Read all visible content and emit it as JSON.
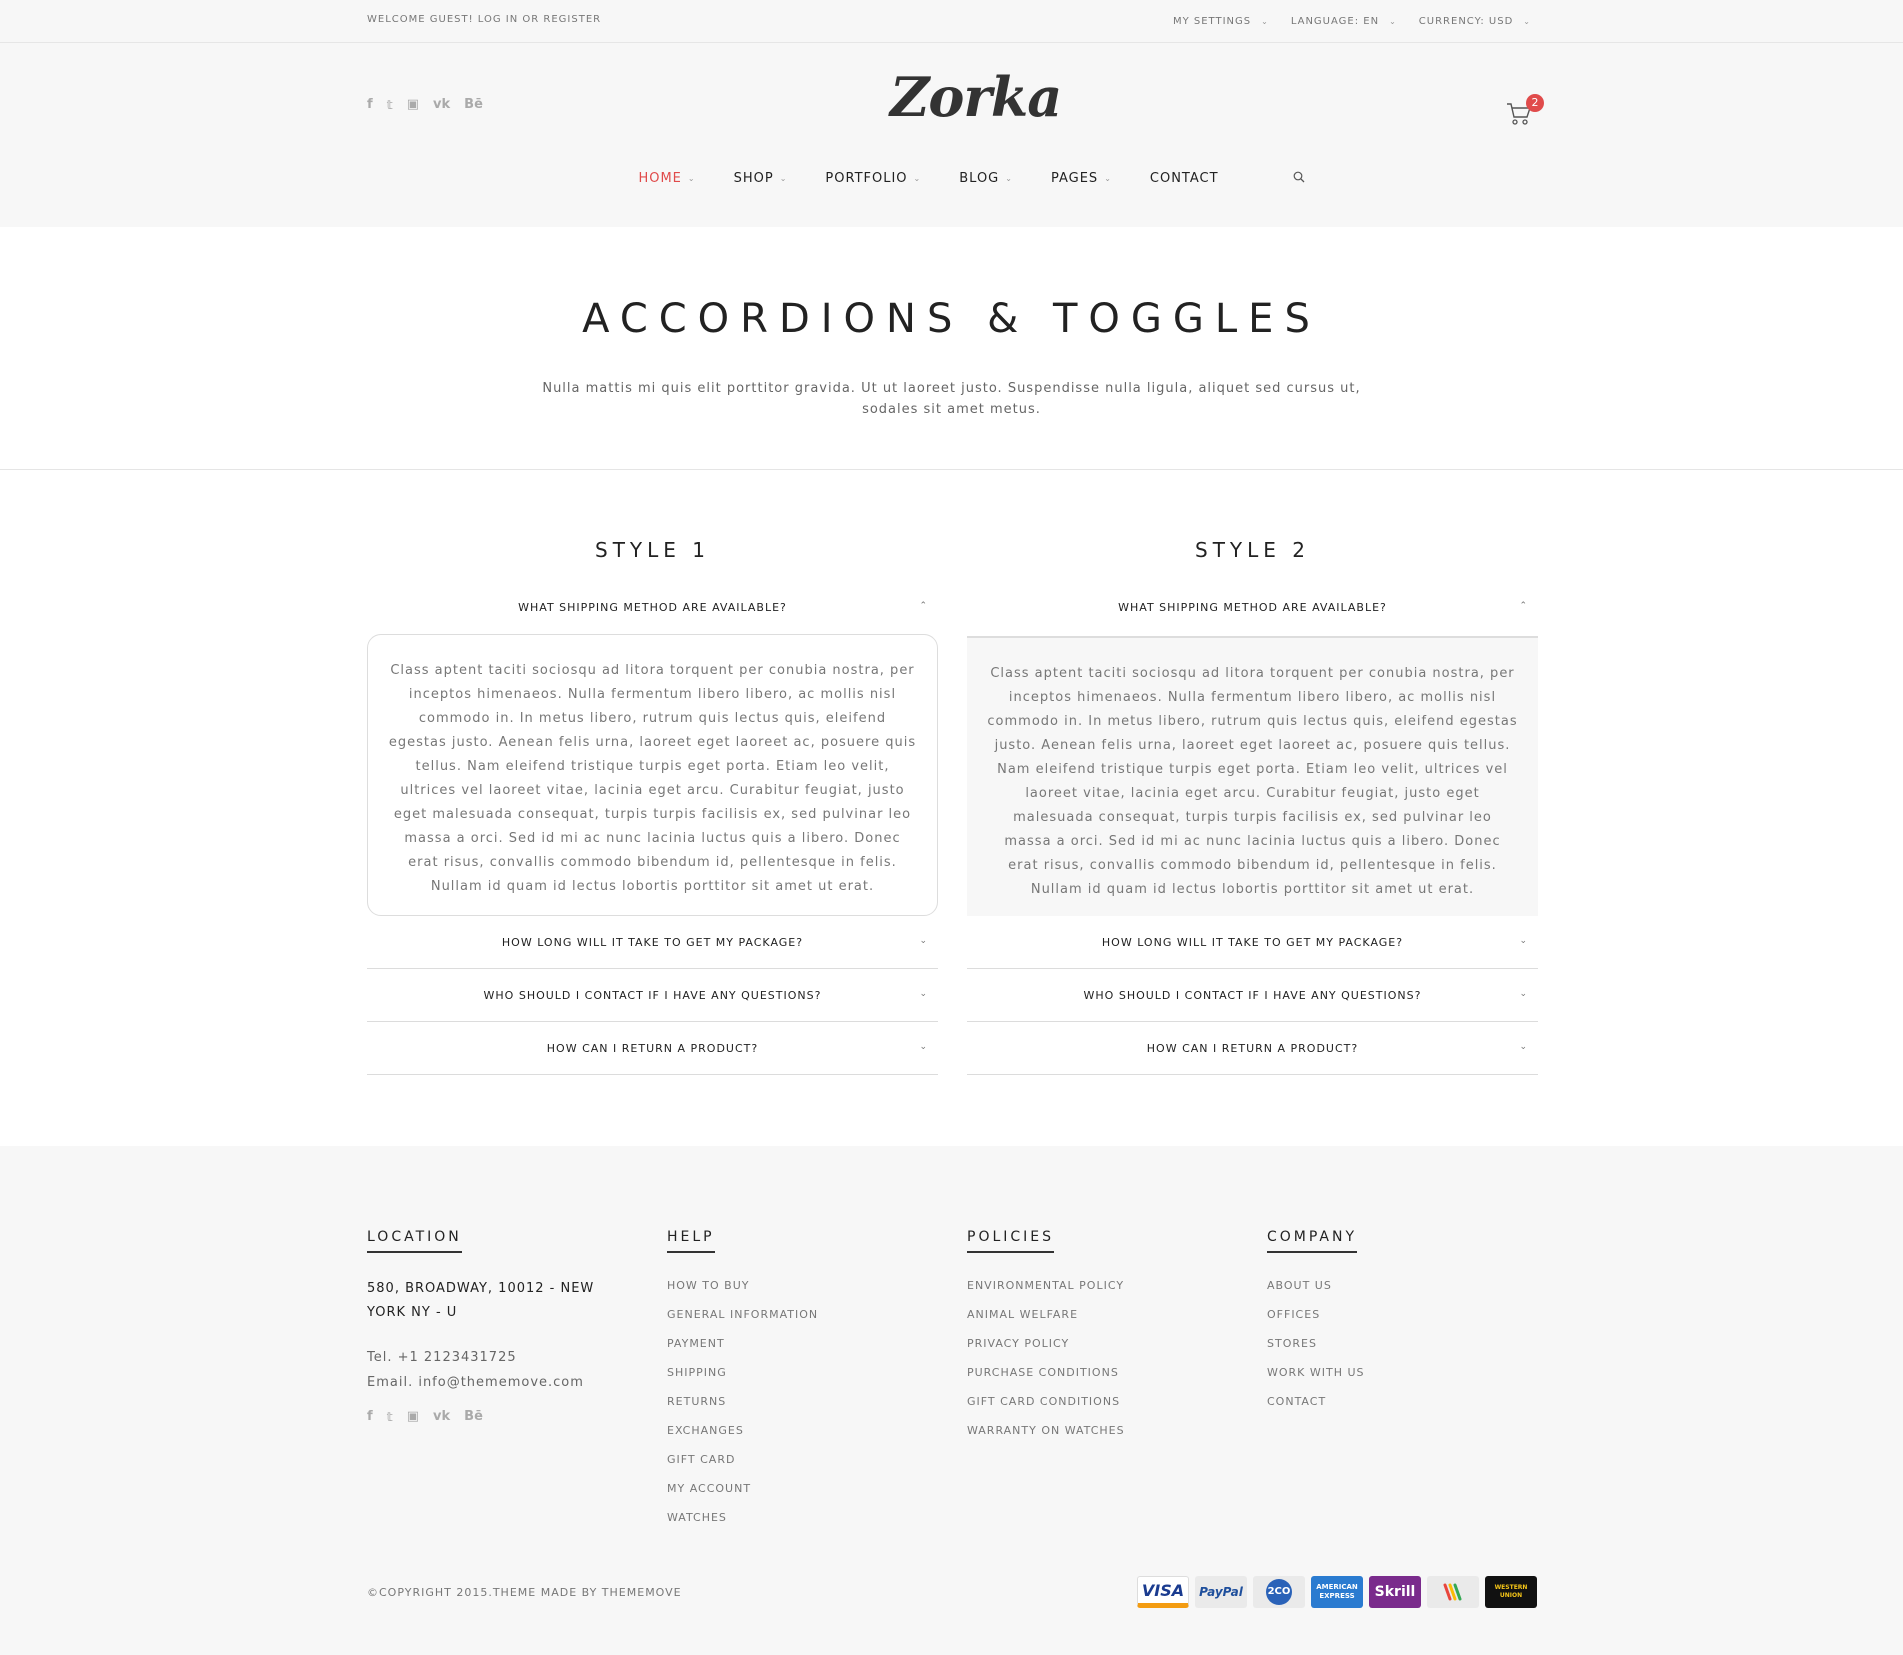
{
  "topbar": {
    "welcome": "WELCOME GUEST! LOG IN OR REGISTER",
    "settings": [
      {
        "label": "MY SETTINGS"
      },
      {
        "label": "LANGUAGE: EN"
      },
      {
        "label": "CURRENCY: USD"
      }
    ]
  },
  "header": {
    "logo": "Zorka",
    "cart_count": "2",
    "social_icons": [
      "facebook-icon",
      "twitter-icon",
      "instagram-icon",
      "vk-icon",
      "behance-icon"
    ]
  },
  "nav": {
    "items": [
      {
        "label": "HOME",
        "active": true,
        "has_dropdown": true
      },
      {
        "label": "SHOP",
        "active": false,
        "has_dropdown": true
      },
      {
        "label": "PORTFOLIO",
        "active": false,
        "has_dropdown": true
      },
      {
        "label": "BLOG",
        "active": false,
        "has_dropdown": true
      },
      {
        "label": "PAGES",
        "active": false,
        "has_dropdown": true
      },
      {
        "label": "CONTACT",
        "active": false,
        "has_dropdown": false
      }
    ]
  },
  "page": {
    "title": "ACCORDIONS & TOGGLES",
    "intro": "Nulla mattis mi quis elit porttitor gravida. Ut ut laoreet justo. Suspendisse nulla ligula, aliquet sed cursus ut, sodales sit amet metus."
  },
  "accordions": [
    {
      "title": "STYLE 1",
      "items": [
        {
          "question": "WHAT SHIPPING METHOD ARE AVAILABLE?",
          "open": true
        },
        {
          "question": "HOW LONG WILL IT TAKE TO GET MY PACKAGE?",
          "open": false
        },
        {
          "question": "WHO SHOULD I CONTACT IF I HAVE ANY QUESTIONS?",
          "open": false
        },
        {
          "question": "HOW CAN I RETURN A PRODUCT?",
          "open": false
        }
      ],
      "answer": "Class aptent taciti sociosqu ad litora torquent per conubia nostra, per inceptos himenaeos. Nulla fermentum libero libero, ac mollis nisl commodo in. In metus libero, rutrum quis lectus quis, eleifend egestas justo. Aenean felis urna, laoreet eget laoreet ac, posuere quis tellus. Nam eleifend tristique turpis eget porta. Etiam leo velit, ultrices vel laoreet vitae, lacinia eget arcu. Curabitur feugiat, justo eget malesuada consequat, turpis turpis facilisis ex, sed pulvinar leo massa a orci. Sed id mi ac nunc lacinia luctus quis a libero. Donec erat risus, convallis commodo bibendum id, pellentesque in felis. Nullam id quam id lectus lobortis porttitor sit amet ut erat."
    },
    {
      "title": "STYLE 2",
      "items": [
        {
          "question": "WHAT SHIPPING METHOD ARE AVAILABLE?",
          "open": true
        },
        {
          "question": "HOW LONG WILL IT TAKE TO GET MY PACKAGE?",
          "open": false
        },
        {
          "question": "WHO SHOULD I CONTACT IF I HAVE ANY QUESTIONS?",
          "open": false
        },
        {
          "question": "HOW CAN I RETURN A PRODUCT?",
          "open": false
        }
      ],
      "answer": "Class aptent taciti sociosqu ad litora torquent per conubia nostra, per inceptos himenaeos. Nulla fermentum libero libero, ac mollis nisl commodo in. In metus libero, rutrum quis lectus quis, eleifend egestas justo. Aenean felis urna, laoreet eget laoreet ac, posuere quis tellus. Nam eleifend tristique turpis eget porta. Etiam leo velit, ultrices vel laoreet vitae, lacinia eget arcu. Curabitur feugiat, justo eget malesuada consequat, turpis turpis facilisis ex, sed pulvinar leo massa a orci. Sed id mi ac nunc lacinia luctus quis a libero. Donec erat risus, convallis commodo bibendum id, pellentesque in felis. Nullam id quam id lectus lobortis porttitor sit amet ut erat."
    }
  ],
  "footer": {
    "location": {
      "title": "LOCATION",
      "address": "580, BROADWAY, 10012 - NEW YORK NY - U",
      "tel": "Tel. +1 2123431725",
      "email": "Email. info@thememove.com"
    },
    "help": {
      "title": "HELP",
      "links": [
        "HOW TO BUY",
        "GENERAL INFORMATION",
        "PAYMENT",
        "SHIPPING",
        "RETURNS",
        "EXCHANGES",
        "GIFT CARD",
        "MY ACCOUNT",
        "WATCHES"
      ]
    },
    "policies": {
      "title": "POLICIES",
      "links": [
        "ENVIRONMENTAL POLICY",
        "ANIMAL WELFARE",
        "PRIVACY POLICY",
        "PURCHASE CONDITIONS",
        "GIFT CARD CONDITIONS",
        "WARRANTY ON WATCHES"
      ]
    },
    "company": {
      "title": "COMPANY",
      "links": [
        "ABOUT US",
        "OFFICES",
        "STORES",
        "WORK WITH US",
        "CONTACT"
      ]
    },
    "copyright": "©COPYRIGHT 2015.THEME MADE BY THEMEMOVE",
    "payments": [
      {
        "name": "VISA",
        "label": "VISA",
        "color": "#1a3b8f"
      },
      {
        "name": "paypal",
        "label": "PayPal",
        "color": "#eaeaea"
      },
      {
        "name": "2co",
        "label": "2CO",
        "color": "#eaeaea"
      },
      {
        "name": "amex",
        "label": "AMERICAN EXPRESS",
        "color": "#2a7bd0"
      },
      {
        "name": "skrill",
        "label": "Skrill",
        "color": "#7a2b8c"
      },
      {
        "name": "google-wallet",
        "label": "",
        "color": "#eaeaea"
      },
      {
        "name": "western-union",
        "label": "WESTERN UNION",
        "color": "#111111"
      }
    ]
  },
  "colors": {
    "accent": "#e04b4b",
    "background": "#f7f7f7"
  }
}
